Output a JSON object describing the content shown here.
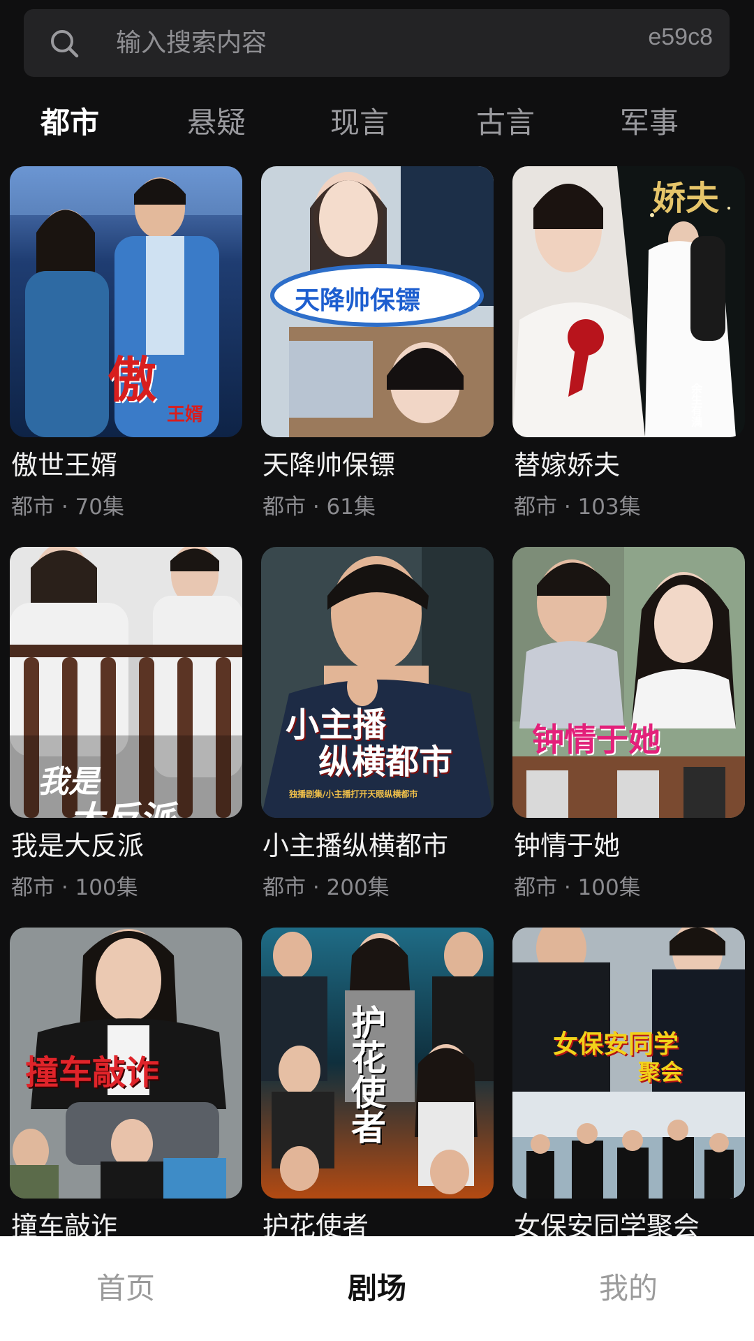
{
  "search": {
    "placeholder": "输入搜索内容",
    "code": "e59c8"
  },
  "tabs": [
    {
      "label": "都市",
      "active": true
    },
    {
      "label": "悬疑",
      "active": false
    },
    {
      "label": "现言",
      "active": false
    },
    {
      "label": "古言",
      "active": false
    },
    {
      "label": "军事",
      "active": false
    }
  ],
  "cards": [
    {
      "title": "傲世王婿",
      "meta": "都市 · 70集",
      "poster_text": "傲",
      "poster_text_sub": "王婿",
      "accent": "#d81e1e"
    },
    {
      "title": "天降帅保镖",
      "meta": "都市 · 61集",
      "poster_text": "天降帅保镖",
      "accent": "#f4d21f"
    },
    {
      "title": "替嫁娇夫",
      "meta": "都市 · 103集",
      "poster_text": "娇夫",
      "poster_text_sub": "余生有满",
      "accent": "#e6c56a"
    },
    {
      "title": "我是大反派",
      "meta": "都市 · 100集",
      "poster_text": "我是",
      "poster_text_sub": "大反派",
      "accent": "#ffffff"
    },
    {
      "title": "小主播纵横都市",
      "meta": "都市 · 200集",
      "poster_text": "小主播",
      "poster_text_sub": "纵横都市",
      "poster_text_small": "独播剧集/小主播打开天眼纵横都市",
      "accent": "#ffffff"
    },
    {
      "title": "钟情于她",
      "meta": "都市 · 100集",
      "poster_text": "钟情于她",
      "accent": "#e3207a"
    },
    {
      "title": "撞车敲诈",
      "meta": "",
      "poster_text": "撞车敲诈",
      "accent": "#e0242a"
    },
    {
      "title": "护花使者",
      "meta": "",
      "poster_text": "护花使者",
      "accent": "#ffffff"
    },
    {
      "title": "女保安同学聚会",
      "meta": "",
      "poster_text": "女保安同学",
      "poster_text_sub": "聚会",
      "accent": "#f2d21a"
    }
  ],
  "nav": [
    {
      "label": "首页",
      "active": false
    },
    {
      "label": "剧场",
      "active": true
    },
    {
      "label": "我的",
      "active": false
    }
  ]
}
